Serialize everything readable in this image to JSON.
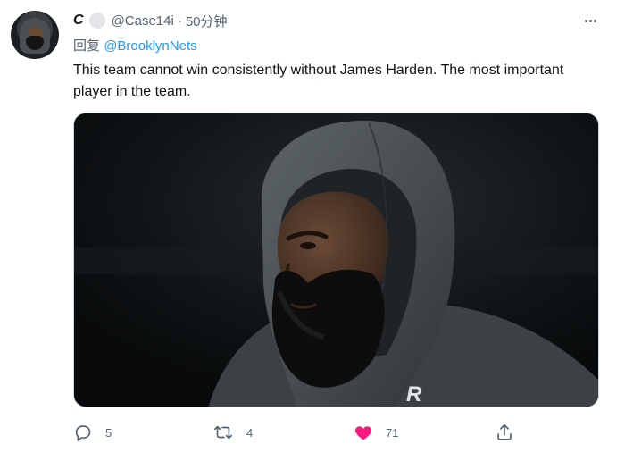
{
  "tweet": {
    "display_name": "C",
    "handle": "@Case14i",
    "separator": "·",
    "time": "50分钟",
    "reply_prefix": "回复",
    "reply_to": "@BrooklynNets",
    "text": "This team cannot win consistently without James Harden. The most important player in the team.",
    "media_description_icon": "photo-of-hooded-basketball-player",
    "hoodie_logo": "R"
  },
  "actions": {
    "reply_count": "5",
    "retweet_count": "4",
    "like_count": "71",
    "liked": true
  },
  "colors": {
    "link": "#1d9bf0",
    "secondary_text": "#536471",
    "like_active": "#f91880"
  },
  "icons": [
    "more-icon",
    "reply-icon",
    "retweet-icon",
    "heart-icon",
    "share-icon"
  ]
}
